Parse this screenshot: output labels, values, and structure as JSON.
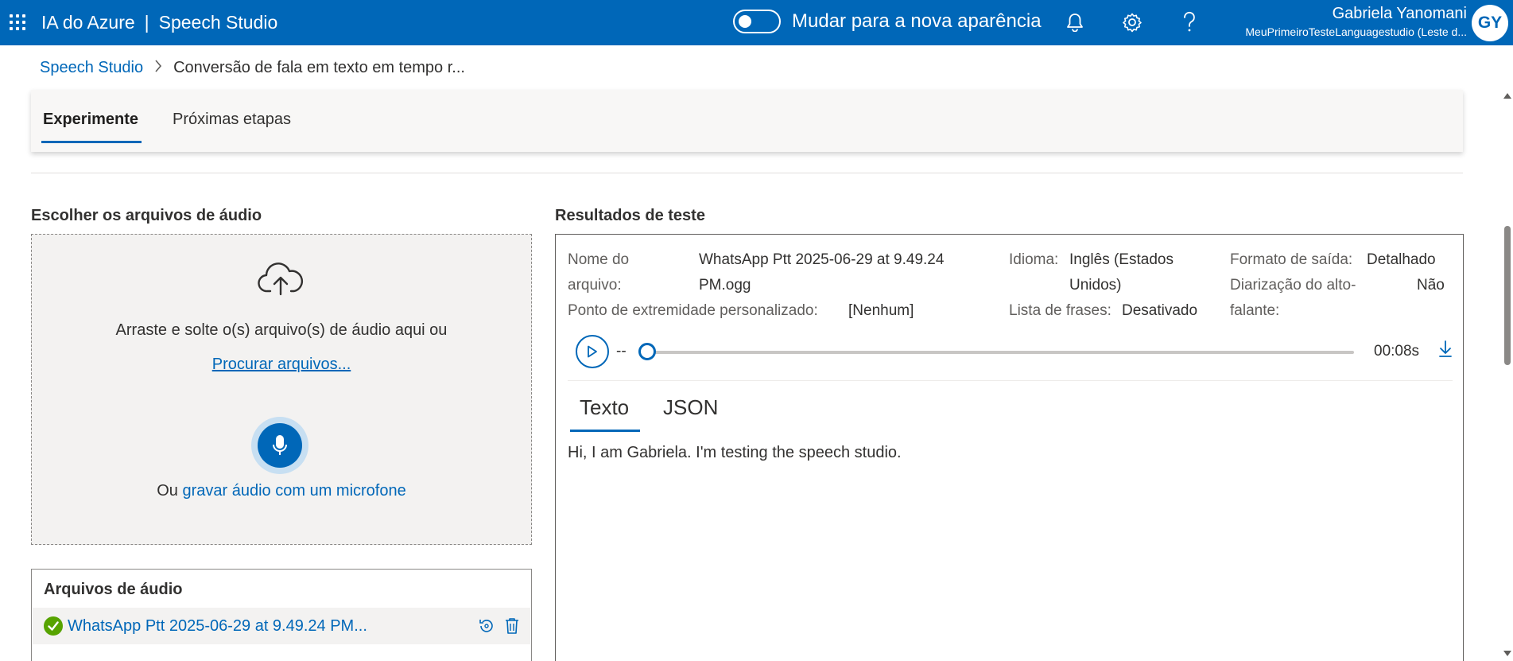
{
  "colors": {
    "accent": "#0067b8",
    "success": "#57a300",
    "topbar": "#0067b8"
  },
  "topbar": {
    "app_name": "IA do Azure",
    "separator": "|",
    "product": "Speech Studio",
    "toggle_label": "Mudar para a nova aparência",
    "toggle_on": false,
    "icons": [
      "waffle-icon",
      "bell-icon",
      "gear-icon",
      "help-icon"
    ],
    "user_name": "Gabriela Yanomani",
    "user_org": "MeuPrimeiroTesteLanguagestudio (Leste d...",
    "avatar_initials": "GY"
  },
  "breadcrumb": {
    "home": "Speech Studio",
    "current": "Conversão de fala em texto em tempo r..."
  },
  "tabs": {
    "experiment": "Experimente",
    "next_steps": "Próximas etapas",
    "active": "experiment"
  },
  "upload": {
    "title": "Escolher os arquivos de áudio",
    "drag_text": "Arraste e solte o(s) arquivo(s) de áudio aqui ou",
    "browse_link": "Procurar arquivos...",
    "or_text": "Ou",
    "record_link": "gravar áudio com um microfone"
  },
  "audio_files": {
    "title": "Arquivos de áudio",
    "items": [
      {
        "name": "WhatsApp Ptt 2025-06-29 at 9.49.24 PM...",
        "status": "success"
      }
    ]
  },
  "results": {
    "title": "Resultados de teste",
    "file_name_label_1": "Nome do",
    "file_name_label_2": "arquivo:",
    "file_name_value_1": "WhatsApp Ptt 2025-06-29 at 9.49.24",
    "file_name_value_2": "PM.ogg",
    "endpoint_label": "Ponto de extremidade personalizado:",
    "endpoint_value": "[Nenhum]",
    "language_label": "Idioma:",
    "language_value_1": "Inglês (Estados",
    "language_value_2": "Unidos)",
    "phrase_list_label": "Lista de frases:",
    "phrase_list_value": "Desativado",
    "output_format_label": "Formato de saída:",
    "output_format_value": "Detalhado",
    "diarization_label_1": "Diarização do alto-",
    "diarization_label_2": "falante:",
    "diarization_value": "Não",
    "player": {
      "current": "--",
      "duration": "00:08s",
      "progress": 0
    },
    "tab_text": "Texto",
    "tab_json": "JSON",
    "active_tab": "text",
    "transcript": "Hi, I am Gabriela. I'm testing the speech studio."
  }
}
